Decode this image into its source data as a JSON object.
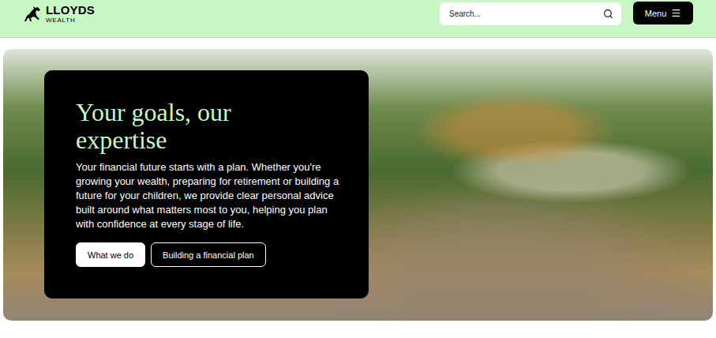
{
  "header": {
    "logo": {
      "name": "LLOYDS",
      "sub": "WEALTH"
    },
    "search": {
      "placeholder": "Search..."
    },
    "menu_button": {
      "label": "Menu"
    }
  },
  "hero": {
    "title": "Your goals, our expertise",
    "body": "Your financial future starts with a plan. Whether you're growing your wealth, preparing for retirement or building a future for your children, we provide clear personal advice built around what matters most to you, helping you plan with confidence at every stage of life.",
    "buttons": [
      {
        "label": "What we do",
        "kind": "primary"
      },
      {
        "label": "Building a financial plan",
        "kind": "secondary"
      }
    ]
  }
}
